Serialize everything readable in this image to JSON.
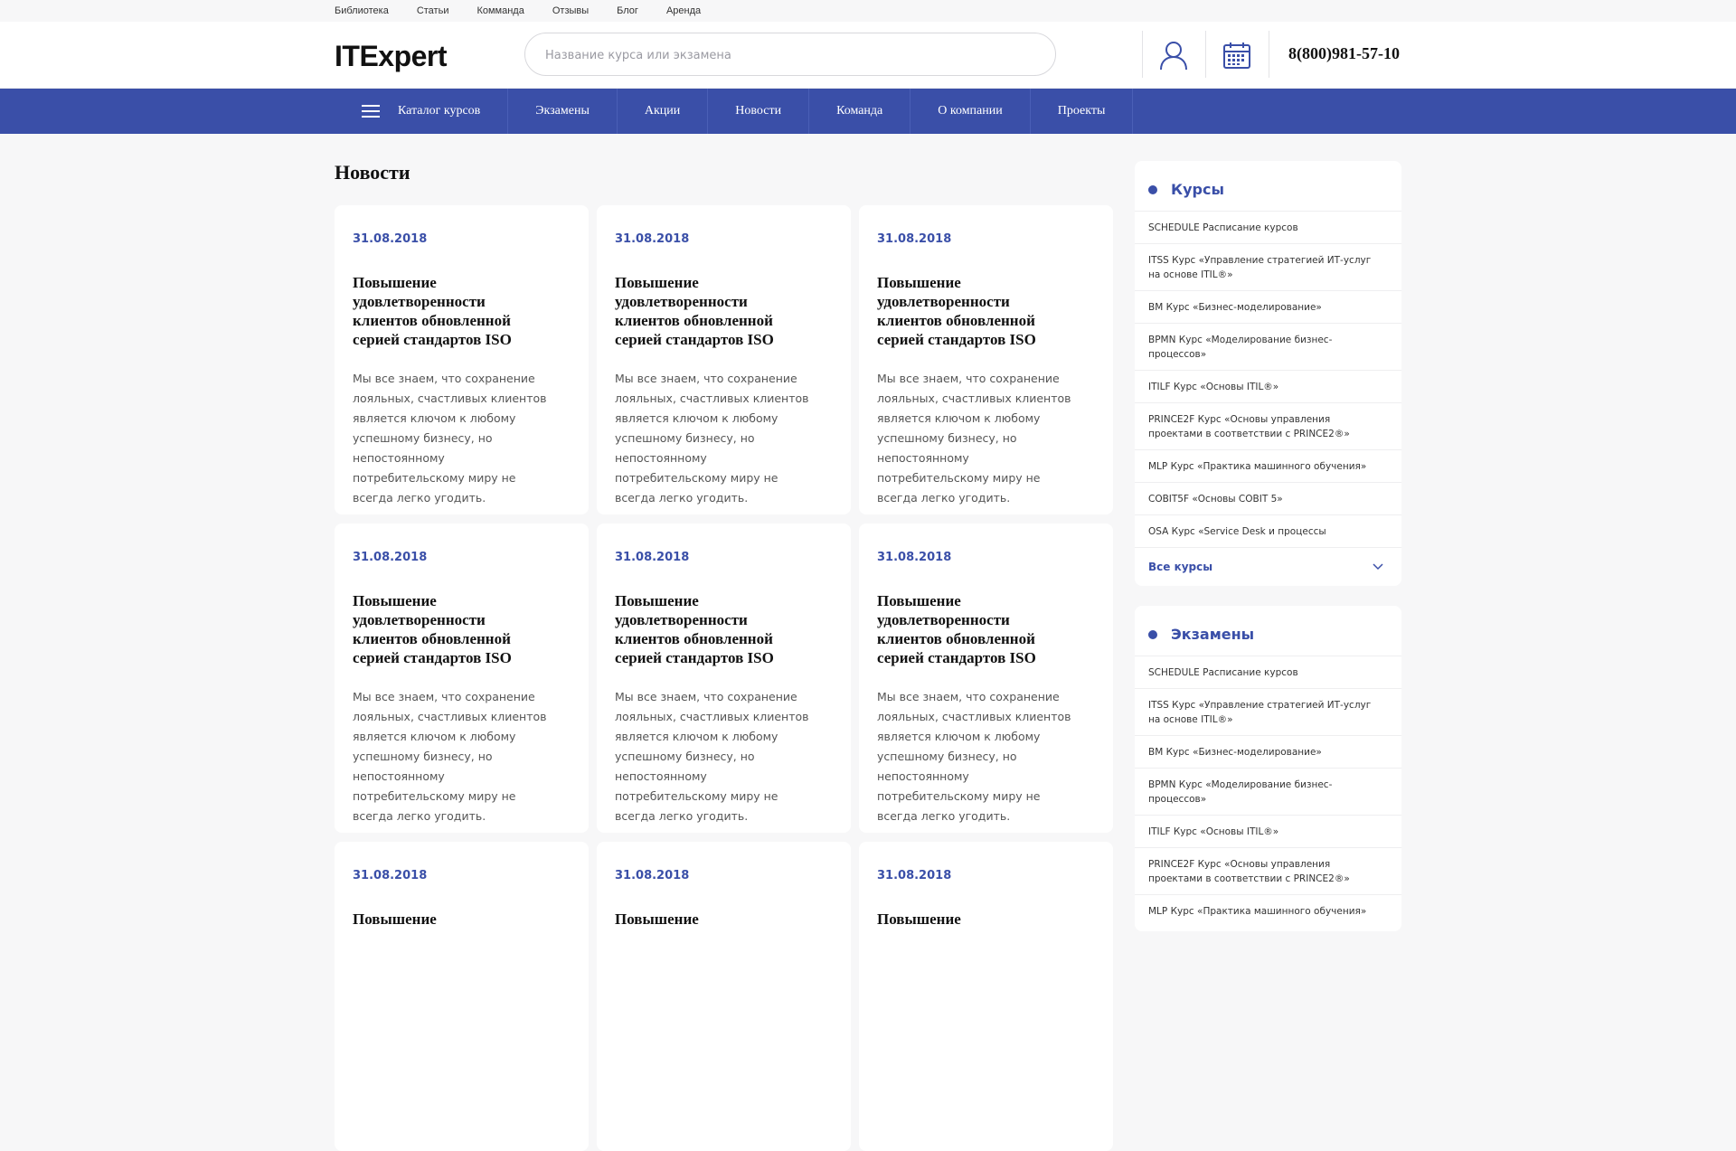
{
  "topbar": {
    "links": [
      "Библиотека",
      "Статьи",
      "Комманда",
      "Отзывы",
      "Блог",
      "Аренда"
    ]
  },
  "header": {
    "logo": "ITExpert",
    "search_placeholder": "Название курса или экзамена",
    "phone": "8(800)981-57-10",
    "icons": [
      "user-icon",
      "calendar-icon"
    ]
  },
  "nav": {
    "items": [
      "Каталог курсов",
      "Экзамены",
      "Акции",
      "Новости",
      "Команда",
      "О компании",
      "Проекты"
    ]
  },
  "main": {
    "title": "Новости",
    "cards": [
      {
        "date": "31.08.2018",
        "title": "Повышение удовлетворенности клиентов обновленной серией стандартов ISO",
        "text": "Мы все знаем, что сохранение лояльных, счастливых клиентов является ключом к любому успешному бизнесу, но непостоянному потребительскому миру не всегда легко угодить."
      },
      {
        "date": "31.08.2018",
        "title": "Повышение удовлетворенности клиентов обновленной серией стандартов ISO",
        "text": "Мы все знаем, что сохранение лояльных, счастливых клиентов является ключом к любому успешному бизнесу, но непостоянному потребительскому миру не всегда легко угодить."
      },
      {
        "date": "31.08.2018",
        "title": "Повышение удовлетворенности клиентов обновленной серией стандартов ISO",
        "text": "Мы все знаем, что сохранение лояльных, счастливых клиентов является ключом к любому успешному бизнесу, но непостоянному потребительскому миру не всегда легко угодить."
      },
      {
        "date": "31.08.2018",
        "title": "Повышение удовлетворенности клиентов обновленной серией стандартов ISO",
        "text": "Мы все знаем, что сохранение лояльных, счастливых клиентов является ключом к любому успешному бизнесу, но непостоянному потребительскому миру не всегда легко угодить."
      },
      {
        "date": "31.08.2018",
        "title": "Повышение удовлетворенности клиентов обновленной серией стандартов ISO",
        "text": "Мы все знаем, что сохранение лояльных, счастливых клиентов является ключом к любому успешному бизнесу, но непостоянному потребительскому миру не всегда легко угодить."
      },
      {
        "date": "31.08.2018",
        "title": "Повышение удовлетворенности клиентов обновленной серией стандартов ISO",
        "text": "Мы все знаем, что сохранение лояльных, счастливых клиентов является ключом к любому успешному бизнесу, но непостоянному потребительскому миру не всегда легко угодить."
      },
      {
        "date": "31.08.2018",
        "title": "Повышение",
        "text": ""
      },
      {
        "date": "31.08.2018",
        "title": "Повышение",
        "text": ""
      },
      {
        "date": "31.08.2018",
        "title": "Повышение",
        "text": ""
      }
    ]
  },
  "sidebar": {
    "courses": {
      "title": "Курсы",
      "items": [
        "SCHEDULE Расписание курсов",
        "ITSS Курс «Управление стратегией ИТ-услуг на основе ITIL®»",
        "BM Курс «Бизнес-моделирование»",
        "BPMN Курс «Моделирование бизнес-процессов»",
        "ITILF Курс «Основы ITIL®»",
        "PRINCE2F Курс «Основы управления проектами в соответствии с PRINCE2®»",
        "MLP Курс «Практика машинного обучения»",
        "COBIT5F «Основы COBIT 5»",
        "OSA Курс «Service Desk и процессы"
      ],
      "all_label": "Все курсы"
    },
    "exams": {
      "title": "Экзамены",
      "items": [
        "SCHEDULE Расписание курсов",
        "ITSS Курс «Управление стратегией ИТ-услуг на основе ITIL®»",
        "BM Курс «Бизнес-моделирование»",
        "BPMN Курс «Моделирование бизнес-процессов»",
        "ITILF Курс «Основы ITIL®»",
        "PRINCE2F Курс «Основы управления проектами в соответствии с PRINCE2®»",
        "MLP Курс «Практика машинного обучения»"
      ]
    }
  },
  "colors": {
    "accent": "#3a4fa8",
    "background": "#f7f7f8"
  }
}
